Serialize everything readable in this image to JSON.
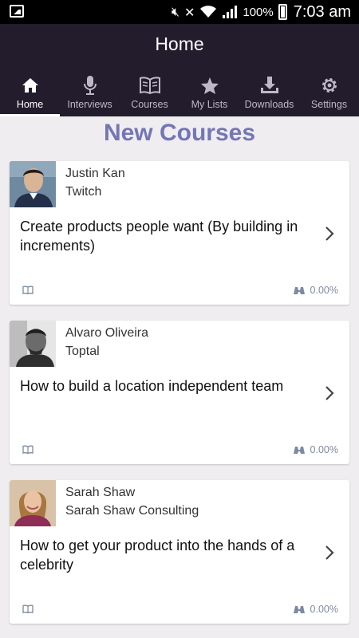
{
  "status_bar": {
    "battery": "100%",
    "time": "7:03 am"
  },
  "app_bar": {
    "title": "Home"
  },
  "tabs": [
    {
      "label": "Home",
      "icon": "home-icon",
      "active": true
    },
    {
      "label": "Interviews",
      "icon": "microphone-icon",
      "active": false
    },
    {
      "label": "Courses",
      "icon": "book-icon",
      "active": false
    },
    {
      "label": "My Lists",
      "icon": "star-icon",
      "active": false
    },
    {
      "label": "Downloads",
      "icon": "download-icon",
      "active": false
    },
    {
      "label": "Settings",
      "icon": "gear-icon",
      "active": false
    }
  ],
  "section": {
    "title": "New Courses"
  },
  "courses": [
    {
      "instructor": "Justin Kan",
      "company": "Twitch",
      "title": "Create products people want (By building in increments)",
      "progress": "0.00%"
    },
    {
      "instructor": "Alvaro Oliveira",
      "company": "Toptal",
      "title": "How to build a location independent team",
      "progress": "0.00%"
    },
    {
      "instructor": "Sarah Shaw",
      "company": "Sarah Shaw Consulting",
      "title": "How to get your product into the hands of a celebrity",
      "progress": "0.00%"
    }
  ],
  "colors": {
    "app_bar_bg": "#221c2d",
    "accent_title": "#7476b5",
    "page_bg": "#efedf0"
  }
}
